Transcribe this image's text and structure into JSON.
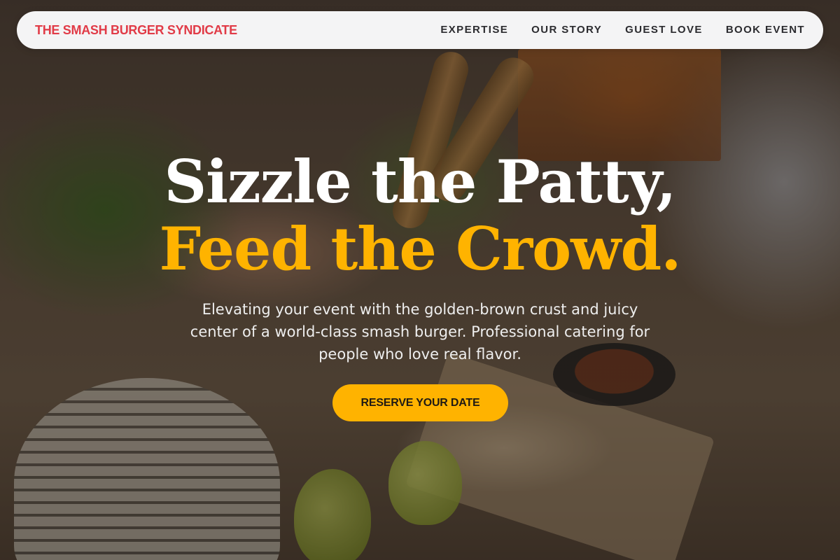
{
  "header": {
    "brand": "THE SMASH BURGER SYNDICATE",
    "nav": [
      {
        "label": "EXPERTISE"
      },
      {
        "label": "OUR STORY"
      },
      {
        "label": "GUEST LOVE"
      },
      {
        "label": "BOOK EVENT"
      }
    ]
  },
  "hero": {
    "headline_line1": "Sizzle the Patty,",
    "headline_line2": "Feed the Crowd.",
    "subtitle": "Elevating your event with the golden-brown crust and juicy center of a world-class smash burger. Professional catering for people who love real flavor.",
    "cta_label": "RESERVE YOUR DATE"
  },
  "colors": {
    "brand": "#e13b47",
    "accent": "#ffb300",
    "nav_background": "#f4f4f5",
    "headline_primary": "#ffffff"
  }
}
